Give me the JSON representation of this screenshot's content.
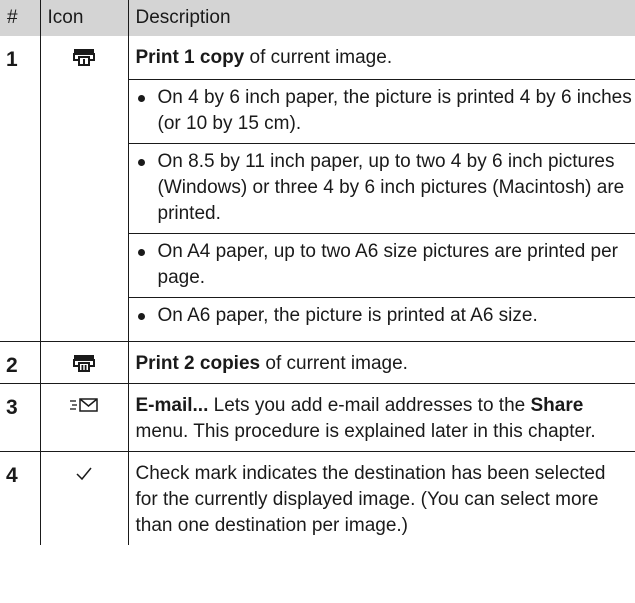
{
  "headers": {
    "num": "#",
    "icon": "Icon",
    "description": "Description"
  },
  "rows": [
    {
      "num": "1",
      "icon": "print-one-copy-icon",
      "term": "Print 1 copy",
      "rest": " of current image.",
      "bullets": [
        "On 4 by 6 inch paper, the picture is printed 4 by 6 inches (or 10 by 15 cm).",
        "On 8.5 by 11 inch paper, up to two 4 by 6 inch pictures (Windows) or three 4 by 6 inch pictures (Macintosh) are printed.",
        "On A4 paper, up to two A6 size pictures are printed per page.",
        "On A6 paper, the picture is printed at A6 size."
      ]
    },
    {
      "num": "2",
      "icon": "print-two-copies-icon",
      "term": "Print 2 copies",
      "rest": " of current image."
    },
    {
      "num": "3",
      "icon": "email-icon",
      "term": "E-mail...",
      "rest": " Lets you add e-mail addresses to the ",
      "term2": "Share",
      "rest2": " menu. This procedure is explained later in this chapter."
    },
    {
      "num": "4",
      "icon": "check-mark-icon",
      "text": "Check mark indicates the destination has been selected for the currently displayed image. (You can select more than one destination per image.)"
    }
  ]
}
